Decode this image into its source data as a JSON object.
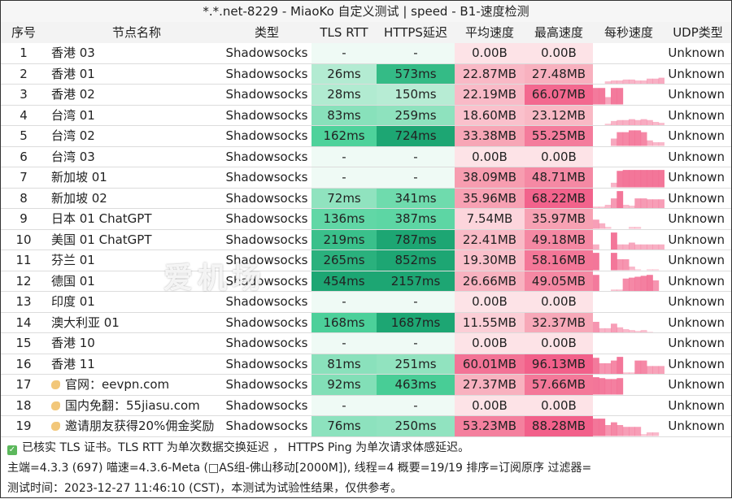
{
  "window": {
    "title": "*.*.net-8229 - MiaoKo 自定义测试 | speed - B1-速度检测"
  },
  "table": {
    "headers": [
      "序号",
      "节点名称",
      "类型",
      "TLS RTT",
      "HTTPS延迟",
      "平均速度",
      "最高速度",
      "每秒速度",
      "UDP类型"
    ],
    "rows": [
      {
        "idx": "1",
        "name": "香港 03",
        "type": "Shadowsocks",
        "tls": "-",
        "https": "-",
        "avg": "0.00B",
        "max": "0.00B",
        "udp": "Unknown",
        "icon": false,
        "tls_ms": null,
        "https_ms": null,
        "avg_mb": 0,
        "max_mb": 0,
        "spark": []
      },
      {
        "idx": "2",
        "name": "香港 01",
        "type": "Shadowsocks",
        "tls": "26ms",
        "https": "573ms",
        "avg": "22.87MB",
        "max": "27.48MB",
        "udp": "Unknown",
        "icon": false,
        "tls_ms": 26,
        "https_ms": 573,
        "avg_mb": 22.87,
        "max_mb": 27.48,
        "spark": [
          0,
          0,
          0.15,
          0.2,
          0.2,
          0.25,
          0.25,
          0.2,
          0.2,
          0.3,
          0.3,
          0.35
        ]
      },
      {
        "idx": "3",
        "name": "香港 02",
        "type": "Shadowsocks",
        "tls": "28ms",
        "https": "150ms",
        "avg": "22.19MB",
        "max": "66.07MB",
        "udp": "Unknown",
        "icon": false,
        "tls_ms": 28,
        "https_ms": 150,
        "avg_mb": 22.19,
        "max_mb": 66.07,
        "spark": [
          0.9,
          0.9,
          0.4,
          0.9,
          0.9,
          0,
          0,
          0,
          0,
          0,
          0,
          0
        ]
      },
      {
        "idx": "4",
        "name": "台湾 01",
        "type": "Shadowsocks",
        "tls": "83ms",
        "https": "259ms",
        "avg": "18.60MB",
        "max": "23.12MB",
        "udp": "Unknown",
        "icon": false,
        "tls_ms": 83,
        "https_ms": 259,
        "avg_mb": 18.6,
        "max_mb": 23.12,
        "spark": [
          0,
          0,
          0.1,
          0.25,
          0.3,
          0.3,
          0.35,
          0.3,
          0.35,
          0.3,
          0.2,
          0.15
        ]
      },
      {
        "idx": "5",
        "name": "台湾 02",
        "type": "Shadowsocks",
        "tls": "162ms",
        "https": "724ms",
        "avg": "33.38MB",
        "max": "55.25MB",
        "udp": "Unknown",
        "icon": false,
        "tls_ms": 162,
        "https_ms": 724,
        "avg_mb": 33.38,
        "max_mb": 55.25,
        "spark": [
          0,
          0,
          0,
          0.4,
          0.75,
          0.75,
          0.85,
          0.85,
          0.75,
          0.3,
          0.2,
          0.2
        ]
      },
      {
        "idx": "6",
        "name": "台湾 03",
        "type": "Shadowsocks",
        "tls": "-",
        "https": "-",
        "avg": "0.00B",
        "max": "0.00B",
        "udp": "Unknown",
        "icon": false,
        "tls_ms": null,
        "https_ms": null,
        "avg_mb": 0,
        "max_mb": 0,
        "spark": []
      },
      {
        "idx": "7",
        "name": "新加坡 01",
        "type": "Shadowsocks",
        "tls": "-",
        "https": "-",
        "avg": "38.09MB",
        "max": "48.71MB",
        "udp": "Unknown",
        "icon": false,
        "tls_ms": null,
        "https_ms": null,
        "avg_mb": 38.09,
        "max_mb": 48.71,
        "spark": [
          0,
          0,
          0,
          0.25,
          0.9,
          0.95,
          0.95,
          0.95,
          0.95,
          0.95,
          0.95,
          0.95
        ]
      },
      {
        "idx": "8",
        "name": "新加坡 02",
        "type": "Shadowsocks",
        "tls": "72ms",
        "https": "341ms",
        "avg": "35.96MB",
        "max": "68.22MB",
        "udp": "Unknown",
        "icon": false,
        "tls_ms": 72,
        "https_ms": 341,
        "avg_mb": 35.96,
        "max_mb": 68.22,
        "spark": [
          0.1,
          0.1,
          0.2,
          0.55,
          0.95,
          0.2,
          0.15,
          0.55,
          0.55,
          0.5,
          0.5,
          0.5
        ]
      },
      {
        "idx": "9",
        "name": "日本 01 ChatGPT",
        "type": "Shadowsocks",
        "tls": "136ms",
        "https": "387ms",
        "avg": "7.54MB",
        "max": "35.97MB",
        "udp": "Unknown",
        "icon": false,
        "tls_ms": 136,
        "https_ms": 387,
        "avg_mb": 7.54,
        "max_mb": 35.97,
        "spark": [
          0.5,
          0.3,
          0.1,
          0,
          0,
          0,
          0.1,
          0.1,
          0,
          0,
          0,
          0
        ]
      },
      {
        "idx": "10",
        "name": "美国 01 ChatGPT",
        "type": "Shadowsocks",
        "tls": "219ms",
        "https": "787ms",
        "avg": "22.41MB",
        "max": "49.18MB",
        "udp": "Unknown",
        "icon": false,
        "tls_ms": 219,
        "https_ms": 787,
        "avg_mb": 22.41,
        "max_mb": 49.18,
        "spark": [
          0.3,
          0,
          0,
          0.95,
          0.3,
          0.3,
          0.4,
          0.3,
          0.3,
          0.3,
          0.3,
          0.3
        ]
      },
      {
        "idx": "11",
        "name": "芬兰 01",
        "type": "Shadowsocks",
        "tls": "265ms",
        "https": "852ms",
        "avg": "19.30MB",
        "max": "58.16MB",
        "udp": "Unknown",
        "icon": false,
        "tls_ms": 265,
        "https_ms": 852,
        "avg_mb": 19.3,
        "max_mb": 58.16,
        "spark": [
          0.95,
          0,
          0,
          0.95,
          0.6,
          0.6,
          0.2,
          0.05,
          0,
          0.05,
          0.05,
          0
        ]
      },
      {
        "idx": "12",
        "name": "德国 01",
        "type": "Shadowsocks",
        "tls": "454ms",
        "https": "2157ms",
        "avg": "26.66MB",
        "max": "49.05MB",
        "udp": "Unknown",
        "icon": false,
        "tls_ms": 454,
        "https_ms": 2157,
        "avg_mb": 26.66,
        "max_mb": 49.05,
        "spark": [
          0.9,
          0,
          0,
          0.1,
          0.1,
          0.7,
          0.75,
          0.8,
          0.85,
          0.9,
          0.6,
          0
        ]
      },
      {
        "idx": "13",
        "name": "印度 01",
        "type": "Shadowsocks",
        "tls": "-",
        "https": "-",
        "avg": "0.00B",
        "max": "0.00B",
        "udp": "Unknown",
        "icon": false,
        "tls_ms": null,
        "https_ms": null,
        "avg_mb": 0,
        "max_mb": 0,
        "spark": []
      },
      {
        "idx": "14",
        "name": "澳大利亚 01",
        "type": "Shadowsocks",
        "tls": "168ms",
        "https": "1687ms",
        "avg": "11.55MB",
        "max": "32.37MB",
        "udp": "Unknown",
        "icon": false,
        "tls_ms": 168,
        "https_ms": 1687,
        "avg_mb": 11.55,
        "max_mb": 32.37,
        "spark": [
          0.6,
          0.25,
          0.25,
          0.5,
          0.3,
          0.2,
          0.15,
          0.1,
          0.15,
          0.05,
          0,
          0
        ]
      },
      {
        "idx": "15",
        "name": "香港 10",
        "type": "Shadowsocks",
        "tls": "-",
        "https": "-",
        "avg": "0.00B",
        "max": "0.00B",
        "udp": "Unknown",
        "icon": false,
        "tls_ms": null,
        "https_ms": null,
        "avg_mb": 0,
        "max_mb": 0,
        "spark": []
      },
      {
        "idx": "16",
        "name": "香港 11",
        "type": "Shadowsocks",
        "tls": "81ms",
        "https": "251ms",
        "avg": "60.01MB",
        "max": "96.13MB",
        "udp": "Unknown",
        "icon": false,
        "tls_ms": 81,
        "https_ms": 251,
        "avg_mb": 60.01,
        "max_mb": 96.13,
        "spark": [
          0.9,
          0.6,
          0.6,
          0.75,
          0.95,
          0.1,
          0.1,
          0.75,
          0.75,
          0.45,
          0.45,
          0.45
        ]
      },
      {
        "idx": "17",
        "name": "官网：eevpn.com",
        "type": "Shadowsocks",
        "tls": "92ms",
        "https": "463ms",
        "avg": "27.37MB",
        "max": "57.66MB",
        "udp": "Unknown",
        "icon": true,
        "tls_ms": 92,
        "https_ms": 463,
        "avg_mb": 27.37,
        "max_mb": 57.66,
        "spark": [
          0.95,
          0.9,
          0.85,
          0.85,
          0.9,
          0,
          0,
          0,
          0,
          0,
          0,
          0
        ]
      },
      {
        "idx": "18",
        "name": "国内免翻：55jiasu.com",
        "type": "Shadowsocks",
        "tls": "-",
        "https": "-",
        "avg": "0.00B",
        "max": "0.00B",
        "udp": "Unknown",
        "icon": true,
        "tls_ms": null,
        "https_ms": null,
        "avg_mb": 0,
        "max_mb": 0,
        "spark": []
      },
      {
        "idx": "19",
        "name": "邀请朋友获得20%佣金奖励",
        "type": "Shadowsocks",
        "tls": "76ms",
        "https": "250ms",
        "avg": "53.23MB",
        "max": "88.28MB",
        "udp": "Unknown",
        "icon": true,
        "tls_ms": 76,
        "https_ms": 250,
        "avg_mb": 53.23,
        "max_mb": 88.28,
        "spark": [
          0.95,
          0.95,
          0.6,
          0.75,
          0.6,
          0.5,
          0.5,
          0.5,
          0.1,
          0.2,
          0.2,
          0
        ]
      }
    ]
  },
  "footer": {
    "line1": "已核实 TLS 证书。TLS RTT 为单次数据交换延迟 ， HTTPS Ping 为单次请求体感延迟。",
    "line2": "主端=4.3.3 (697) 喵速=4.3.6-Meta (□AS组-佛山移动[2000M]), 线程=4 概要=19/19 排序=订阅原序 过滤器=",
    "line3": "测试时间：2023-12-27 11:46:10 (CST)，本测试为试验性结果，仅供参考。"
  },
  "watermark": {
    "text": "爱机场"
  },
  "colors": {
    "green_light": "#b7ecd4",
    "green_mid": "#4fd39c",
    "green_dark": "#1da673",
    "pink_light": "#fde3e7",
    "pink_mid": "#f7a3b4",
    "pink_dark": "#f2608a",
    "spark": "#f26a90"
  }
}
